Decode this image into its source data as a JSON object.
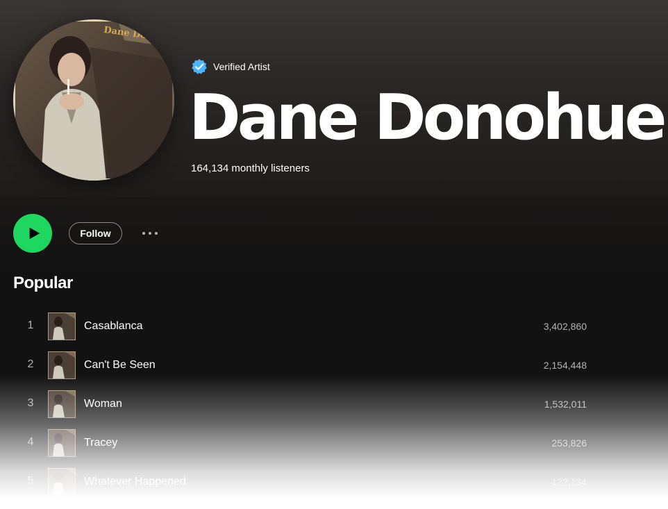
{
  "artist": {
    "verified_label": "Verified Artist",
    "name": "Dane Donohue",
    "monthly_listeners": "164,134 monthly listeners",
    "avatar_caption": "Dane Donoh"
  },
  "actions": {
    "play_icon": "play-icon",
    "follow_label": "Follow",
    "more_icon": "more-horizontal-icon"
  },
  "popular": {
    "title": "Popular",
    "tracks": [
      {
        "num": "1",
        "title": "Casablanca",
        "plays": "3,402,860"
      },
      {
        "num": "2",
        "title": "Can't Be Seen",
        "plays": "2,154,448"
      },
      {
        "num": "3",
        "title": "Woman",
        "plays": "1,532,011"
      },
      {
        "num": "4",
        "title": "Tracey",
        "plays": "253,826"
      },
      {
        "num": "5",
        "title": "Whatever Happened",
        "plays": "122,134"
      }
    ]
  },
  "colors": {
    "play_button": "#1ed760",
    "verified_badge": "#4cb3ff",
    "background": "#121212"
  }
}
